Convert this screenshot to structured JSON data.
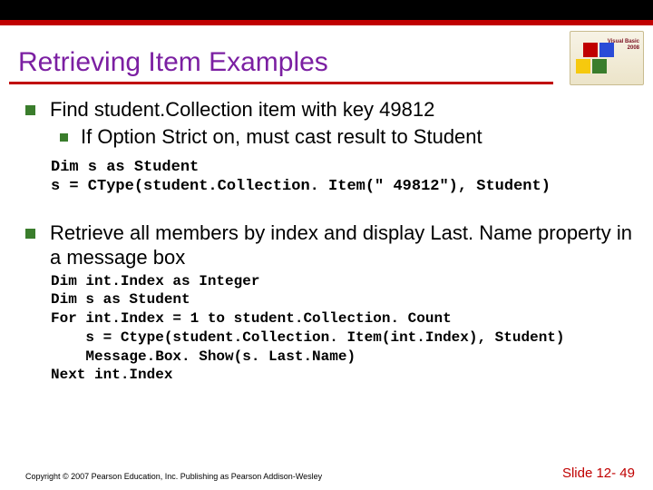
{
  "title": "Retrieving Item Examples",
  "bullet1": "Find student.Collection item with key 49812",
  "bullet1_sub": "If Option Strict on, must cast result to Student",
  "code1": "Dim s as Student\ns = CType(student.Collection. Item(\" 49812\"), Student)",
  "bullet2": "Retrieve all members by index and display Last. Name property in a message box",
  "code2": "Dim int.Index as Integer\nDim s as Student\nFor int.Index = 1 to student.Collection. Count\n    s = Ctype(student.Collection. Item(int.Index), Student)\n    Message.Box. Show(s. Last.Name)\nNext int.Index",
  "copyright": "Copyright © 2007 Pearson Education, Inc. Publishing as Pearson Addison-Wesley",
  "slide": "Slide 12- 49"
}
